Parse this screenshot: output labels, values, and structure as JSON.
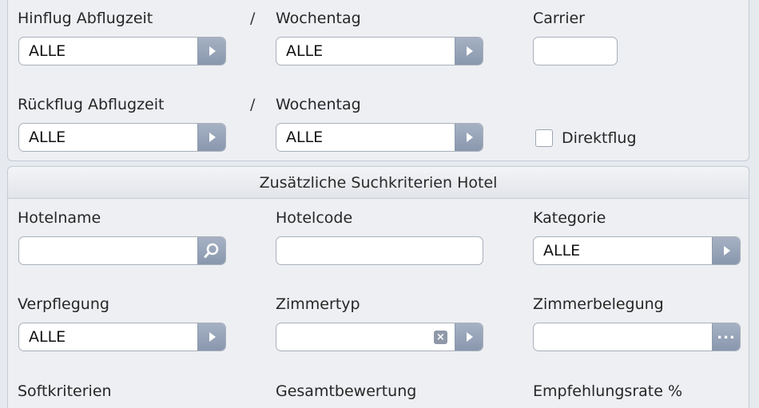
{
  "flight": {
    "outbound_time_label": "Hinflug Abflugzeit",
    "outbound_time_value": "ALLE",
    "separator": "/",
    "outbound_weekday_label": "Wochentag",
    "outbound_weekday_value": "ALLE",
    "carrier_label": "Carrier",
    "carrier_value": "",
    "return_time_label": "Rückflug Abflugzeit",
    "return_time_value": "ALLE",
    "return_weekday_label": "Wochentag",
    "return_weekday_value": "ALLE",
    "direct_flight_label": "Direktflug",
    "direct_flight_checked": false
  },
  "hotel": {
    "section_title": "Zusätzliche Suchkriterien Hotel",
    "hotelname_label": "Hotelname",
    "hotelname_value": "",
    "hotelcode_label": "Hotelcode",
    "hotelcode_value": "",
    "category_label": "Kategorie",
    "category_value": "ALLE",
    "board_label": "Verpflegung",
    "board_value": "ALLE",
    "roomtype_label": "Zimmertyp",
    "roomtype_value": "",
    "occupancy_label": "Zimmerbelegung",
    "occupancy_value": "",
    "soft_criteria_label": "Softkriterien",
    "overall_rating_label": "Gesamtbewertung",
    "recommendation_rate_label": "Empfehlungsrate %"
  },
  "icons": {
    "dropdown": "chevron-right-icon",
    "search": "search-icon",
    "clear": "clear-icon",
    "more": "ellipsis-icon"
  },
  "colors": {
    "button_gradient_top": "#a6b1c3",
    "button_gradient_bottom": "#8997ae",
    "panel_background": "#edeff2"
  }
}
